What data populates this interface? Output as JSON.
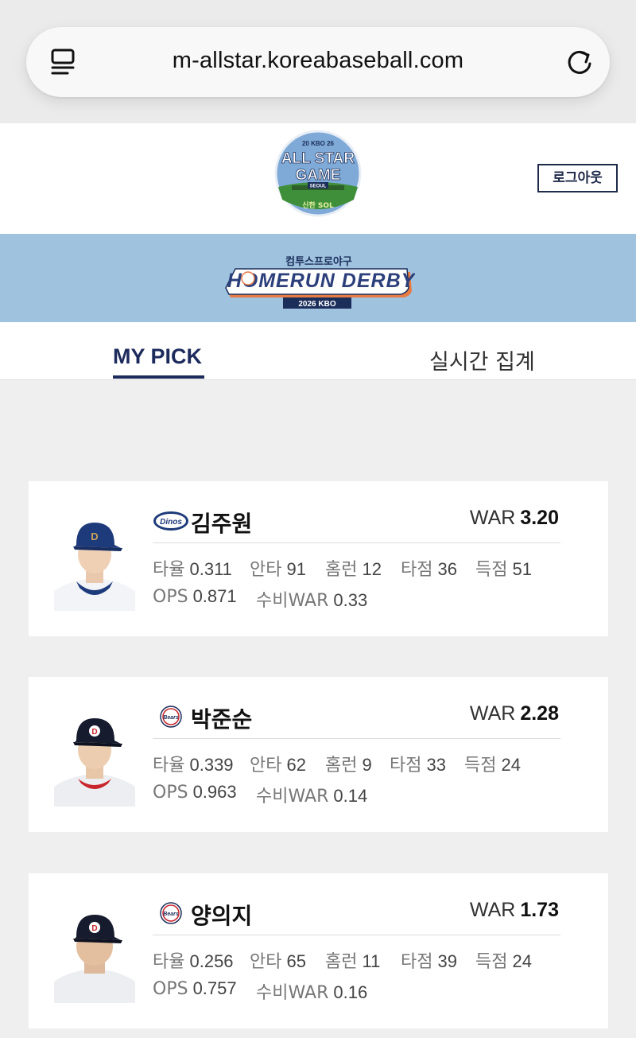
{
  "browser": {
    "url": "m-allstar.koreabaseball.com",
    "reader_icon": "reader-icon",
    "reload_icon": "reload-icon"
  },
  "header": {
    "logo_top": "20 KBO 26",
    "logo_line1": "ALL STAR",
    "logo_line2": "GAME",
    "logo_sub": "SEOUL",
    "logo_sponsor": "신한 SOL",
    "logout_label": "로그아웃"
  },
  "banner": {
    "sponsor": "컴투스프로야구",
    "title": "HOMERUN DERBY",
    "subtitle": "2026 KBO"
  },
  "tabs": {
    "my_pick": "MY PICK",
    "live": "실시간 집계"
  },
  "colors": {
    "brand_navy": "#1c2a5c",
    "banner_blue": "#9fc2df",
    "page_bg": "#efefef"
  },
  "stat_labels": {
    "avg": "타율",
    "hits": "안타",
    "hr": "홈런",
    "rbi": "타점",
    "runs": "득점",
    "ops": "OPS",
    "def_war": "수비WAR",
    "war": "WAR"
  },
  "players": [
    {
      "name": "김주원",
      "team_logo": "dinos-logo",
      "team_text": "Dinos",
      "war": "3.20",
      "avg": "0.311",
      "hits": "91",
      "hr": "12",
      "rbi": "36",
      "runs": "51",
      "ops": "0.871",
      "def_war": "0.33"
    },
    {
      "name": "박준순",
      "team_logo": "bears-logo",
      "team_text": "Bears",
      "war": "2.28",
      "avg": "0.339",
      "hits": "62",
      "hr": "9",
      "rbi": "33",
      "runs": "24",
      "ops": "0.963",
      "def_war": "0.14"
    },
    {
      "name": "양의지",
      "team_logo": "bears-logo",
      "team_text": "Bears",
      "war": "1.73",
      "avg": "0.256",
      "hits": "65",
      "hr": "11",
      "rbi": "39",
      "runs": "24",
      "ops": "0.757",
      "def_war": "0.16"
    }
  ]
}
